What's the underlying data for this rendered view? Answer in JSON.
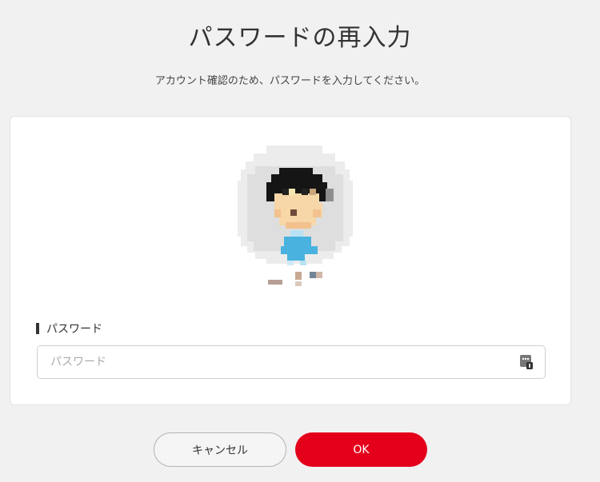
{
  "page": {
    "title": "パスワードの再入力",
    "subtitle": "アカウント確認のため、パスワードを入力してください。"
  },
  "form": {
    "password_label": "パスワード",
    "password_placeholder": "パスワード",
    "password_value": "",
    "keyboard_icon": "keypad-icon"
  },
  "buttons": {
    "cancel_label": "キャンセル",
    "ok_label": "OK"
  },
  "colors": {
    "background": "#f1f1f1",
    "card": "#ffffff",
    "ok_button": "#e4001b",
    "cancel_button_border": "#b3b3b3",
    "avatar_circle": "#e4e4e4"
  },
  "avatar": {
    "icon": "pixel-avatar-icon"
  }
}
